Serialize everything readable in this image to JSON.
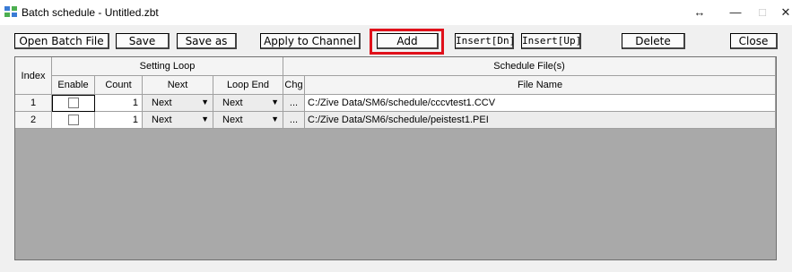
{
  "window": {
    "title": "Batch schedule - Untitled.zbt",
    "controls": {
      "resize": "↔",
      "minimize": "—",
      "maximize": "□",
      "close": "✕"
    }
  },
  "toolbar": {
    "open": "Open Batch File",
    "save": "Save",
    "save_as": "Save as",
    "apply": "Apply to Channel",
    "add": "Add",
    "insert_dn": "Insert[Dn]",
    "insert_up": "Insert[Up]",
    "delete": "Delete",
    "close": "Close"
  },
  "table": {
    "group_headers": {
      "setting_loop": "Setting Loop",
      "schedule_files": "Schedule File(s)"
    },
    "columns": {
      "index": "Index",
      "enable": "Enable",
      "count": "Count",
      "next": "Next",
      "loop_end": "Loop End",
      "chg": "Chg",
      "file_name": "File Name"
    },
    "rows": [
      {
        "index": "1",
        "count": "1",
        "next": "Next",
        "loop_end": "Next",
        "chg": "...",
        "file": "C:/Zive Data/SM6/schedule/cccvtest1.CCV"
      },
      {
        "index": "2",
        "count": "1",
        "next": "Next",
        "loop_end": "Next",
        "chg": "...",
        "file": "C:/Zive Data/SM6/schedule/peistest1.PEI"
      }
    ]
  }
}
